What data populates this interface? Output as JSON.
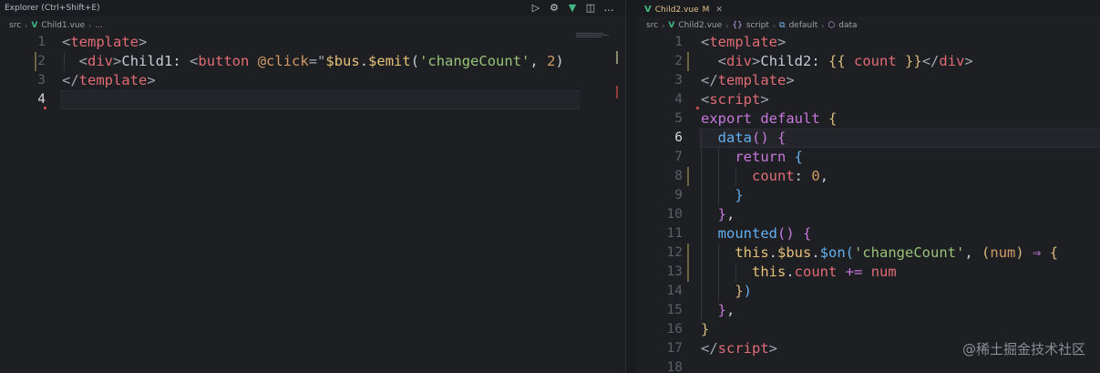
{
  "left_pane": {
    "header_title": "Explorer (Ctrl+Shift+E)",
    "header_actions": [
      "run-icon",
      "debug-icon",
      "vue-icon",
      "split-editor-icon",
      "more-icon"
    ],
    "breadcrumb": [
      "src",
      "Child1.vue",
      "..."
    ],
    "lines": [
      {
        "num": "1",
        "parts": [
          [
            "t-punc",
            "<"
          ],
          [
            "t-tag",
            "template"
          ],
          [
            "t-punc",
            ">"
          ]
        ]
      },
      {
        "num": "2",
        "parts": [
          [
            "t-plain",
            "  "
          ],
          [
            "t-punc",
            "<"
          ],
          [
            "t-tag",
            "div"
          ],
          [
            "t-punc",
            ">"
          ],
          [
            "t-plain",
            "Child1: "
          ],
          [
            "t-punc",
            "<"
          ],
          [
            "t-tag",
            "button"
          ],
          [
            "t-plain",
            " "
          ],
          [
            "t-attr",
            "@click"
          ],
          [
            "t-punc",
            "=\""
          ],
          [
            "t-var",
            "$bus"
          ],
          [
            "t-plain",
            "."
          ],
          [
            "t-var",
            "$emit"
          ],
          [
            "t-plain",
            "("
          ],
          [
            "t-str",
            "'changeCount'"
          ],
          [
            "t-plain",
            ", "
          ],
          [
            "t-num",
            "2"
          ],
          [
            "t-plain",
            ")"
          ]
        ]
      },
      {
        "num": "3",
        "parts": [
          [
            "t-punc",
            "</"
          ],
          [
            "t-tag",
            "template"
          ],
          [
            "t-punc",
            ">"
          ]
        ]
      },
      {
        "num": "4",
        "parts": []
      }
    ],
    "active_line": "4"
  },
  "right_pane": {
    "tab_label": "Child2.vue",
    "tab_status": "M",
    "breadcrumb": [
      "src",
      "Child2.vue",
      "script",
      "default",
      "data"
    ],
    "lines": [
      {
        "num": "1",
        "parts": [
          [
            "t-punc",
            "<"
          ],
          [
            "t-tag",
            "template"
          ],
          [
            "t-punc",
            ">"
          ]
        ]
      },
      {
        "num": "2",
        "parts": [
          [
            "t-plain",
            "  "
          ],
          [
            "t-punc",
            "<"
          ],
          [
            "t-tag",
            "div"
          ],
          [
            "t-punc",
            ">"
          ],
          [
            "t-plain",
            "Child2: "
          ],
          [
            "t-brace",
            "{{ "
          ],
          [
            "t-prop",
            "count"
          ],
          [
            "t-brace",
            " }}"
          ],
          [
            "t-punc",
            "</"
          ],
          [
            "t-tag",
            "div"
          ],
          [
            "t-punc",
            ">"
          ]
        ]
      },
      {
        "num": "3",
        "parts": [
          [
            "t-punc",
            "</"
          ],
          [
            "t-tag",
            "template"
          ],
          [
            "t-punc",
            ">"
          ]
        ]
      },
      {
        "num": "4",
        "parts": [
          [
            "t-punc",
            "<"
          ],
          [
            "t-tag",
            "script"
          ],
          [
            "t-punc",
            ">"
          ]
        ]
      },
      {
        "num": "5",
        "parts": [
          [
            "t-kw",
            "export default"
          ],
          [
            "t-plain",
            " "
          ],
          [
            "t-brace",
            "{"
          ]
        ]
      },
      {
        "num": "6",
        "parts": [
          [
            "t-plain",
            "  "
          ],
          [
            "t-fn",
            "data"
          ],
          [
            "t-brace2",
            "()"
          ],
          [
            "t-plain",
            " "
          ],
          [
            "t-brace2",
            "{"
          ]
        ]
      },
      {
        "num": "7",
        "parts": [
          [
            "t-plain",
            "    "
          ],
          [
            "t-kw",
            "return"
          ],
          [
            "t-plain",
            " "
          ],
          [
            "t-brace3",
            "{"
          ]
        ]
      },
      {
        "num": "8",
        "parts": [
          [
            "t-plain",
            "      "
          ],
          [
            "t-prop",
            "count"
          ],
          [
            "t-plain",
            ": "
          ],
          [
            "t-num",
            "0"
          ],
          [
            "t-plain",
            ","
          ]
        ]
      },
      {
        "num": "9",
        "parts": [
          [
            "t-plain",
            "    "
          ],
          [
            "t-brace3",
            "}"
          ]
        ]
      },
      {
        "num": "10",
        "parts": [
          [
            "t-plain",
            "  "
          ],
          [
            "t-brace2",
            "}"
          ],
          [
            "t-plain",
            ","
          ]
        ]
      },
      {
        "num": "11",
        "parts": [
          [
            "t-plain",
            "  "
          ],
          [
            "t-fn",
            "mounted"
          ],
          [
            "t-brace2",
            "()"
          ],
          [
            "t-plain",
            " "
          ],
          [
            "t-brace2",
            "{"
          ]
        ]
      },
      {
        "num": "12",
        "parts": [
          [
            "t-plain",
            "    "
          ],
          [
            "t-this",
            "this"
          ],
          [
            "t-plain",
            "."
          ],
          [
            "t-var",
            "$bus"
          ],
          [
            "t-plain",
            "."
          ],
          [
            "t-fn",
            "$on"
          ],
          [
            "t-brace3",
            "("
          ],
          [
            "t-str",
            "'changeCount'"
          ],
          [
            "t-plain",
            ", "
          ],
          [
            "t-brace",
            "("
          ],
          [
            "t-attr",
            "num"
          ],
          [
            "t-brace",
            ")"
          ],
          [
            "t-plain",
            " "
          ],
          [
            "t-op",
            "⇒"
          ],
          [
            "t-plain",
            " "
          ],
          [
            "t-brace",
            "{"
          ]
        ]
      },
      {
        "num": "13",
        "parts": [
          [
            "t-plain",
            "      "
          ],
          [
            "t-this",
            "this"
          ],
          [
            "t-plain",
            "."
          ],
          [
            "t-prop",
            "count"
          ],
          [
            "t-plain",
            " "
          ],
          [
            "t-op",
            "+="
          ],
          [
            "t-plain",
            " "
          ],
          [
            "t-prop",
            "num"
          ]
        ]
      },
      {
        "num": "14",
        "parts": [
          [
            "t-plain",
            "    "
          ],
          [
            "t-brace",
            "}"
          ],
          [
            "t-brace3",
            ")"
          ]
        ]
      },
      {
        "num": "15",
        "parts": [
          [
            "t-plain",
            "  "
          ],
          [
            "t-brace2",
            "}"
          ],
          [
            "t-plain",
            ","
          ]
        ]
      },
      {
        "num": "16",
        "parts": [
          [
            "t-brace",
            "}"
          ]
        ]
      },
      {
        "num": "17",
        "parts": [
          [
            "t-punc",
            "</"
          ],
          [
            "t-tag",
            "script"
          ],
          [
            "t-punc",
            ">"
          ]
        ]
      },
      {
        "num": "18",
        "parts": []
      }
    ],
    "active_line": "6"
  },
  "watermark": "@稀土掘金技术社区"
}
